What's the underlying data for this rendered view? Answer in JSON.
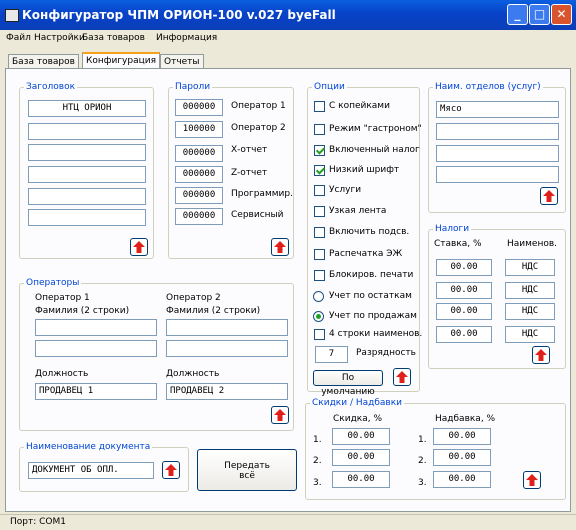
{
  "window": {
    "title": "Конфигуратор ЧПМ ОРИОН-100 v.027 byeFall"
  },
  "menu": [
    "Файл",
    "Настройки",
    "База товаров",
    "Информация"
  ],
  "tabs": [
    "База товаров",
    "Конфигурация",
    "Отчеты"
  ],
  "header_group": {
    "title": "Заголовок",
    "lines": [
      "НТЦ ОРИОН",
      "",
      "",
      "",
      "",
      ""
    ]
  },
  "passwords_group": {
    "title": "Пароли",
    "rows": [
      {
        "value": "000000",
        "label": "Оператор 1"
      },
      {
        "value": "100000",
        "label": "Оператор 2"
      },
      {
        "value": "000000",
        "label": "Х-отчет"
      },
      {
        "value": "000000",
        "label": "Z-отчет"
      },
      {
        "value": "000000",
        "label": "Программир."
      },
      {
        "value": "000000",
        "label": "Сервисный"
      }
    ]
  },
  "operators_group": {
    "title": "Операторы",
    "op1": "Оператор 1",
    "op2": "Оператор 2",
    "surname_label": "Фамилия (2 строки)",
    "position_label": "Должность",
    "op1_position": "ПРОДАВЕЦ 1",
    "op2_position": "ПРОДАВЕЦ 2"
  },
  "document_group": {
    "title": "Наименование документа",
    "value": "ДОКУМЕНТ ОБ ОПЛ."
  },
  "transfer_button": {
    "line1": "Передать",
    "line2": "всё"
  },
  "options_group": {
    "title": "Опции",
    "items": [
      {
        "label": "С копейками",
        "checked": false
      },
      {
        "label": "Режим \"гастроном\"",
        "checked": false
      },
      {
        "label": "Включенный налог",
        "checked": true
      },
      {
        "label": "Низкий шрифт",
        "checked": true
      },
      {
        "label": "Услуги",
        "checked": false
      },
      {
        "label": "Узкая лента",
        "checked": false
      },
      {
        "label": "Включить подсв.",
        "checked": false
      },
      {
        "label": "Распечатка ЭЖ",
        "checked": false
      },
      {
        "label": "Блокиров. печати",
        "checked": false
      }
    ],
    "radios": [
      {
        "label": "Учет по остаткам",
        "checked": false
      },
      {
        "label": "Учет по продажам",
        "checked": true
      }
    ],
    "four_lines": {
      "label": "4 строки наименов.",
      "checked": false
    },
    "digits": {
      "value": "7",
      "label": "Разрядность"
    },
    "default_button": "По умолчанию"
  },
  "departments_group": {
    "title": "Наим. отделов (услуг)",
    "lines": [
      "Мясо",
      "",
      "",
      ""
    ]
  },
  "taxes_group": {
    "title": "Налоги",
    "col_rate": "Ставка, %",
    "col_name": "Наименов.",
    "rows": [
      {
        "rate": "00.00",
        "name": "НДС"
      },
      {
        "rate": "00.00",
        "name": "НДС"
      },
      {
        "rate": "00.00",
        "name": "НДС"
      },
      {
        "rate": "00.00",
        "name": "НДС"
      }
    ]
  },
  "discounts_group": {
    "title": "Скидки / Надбавки",
    "col_discount": "Скидка, %",
    "col_markup": "Надбавка, %",
    "rows": [
      {
        "n": "1.",
        "discount": "00.00",
        "markup": "00.00"
      },
      {
        "n": "2.",
        "discount": "00.00",
        "markup": "00.00"
      },
      {
        "n": "3.",
        "discount": "00.00",
        "markup": "00.00"
      }
    ]
  },
  "status": {
    "port": "Порт: COM1"
  },
  "colors": {
    "title_bar": "#0842c8",
    "group_title": "#0046d5",
    "up_arrow": "#e0201b",
    "check_mark": "#21a121"
  }
}
